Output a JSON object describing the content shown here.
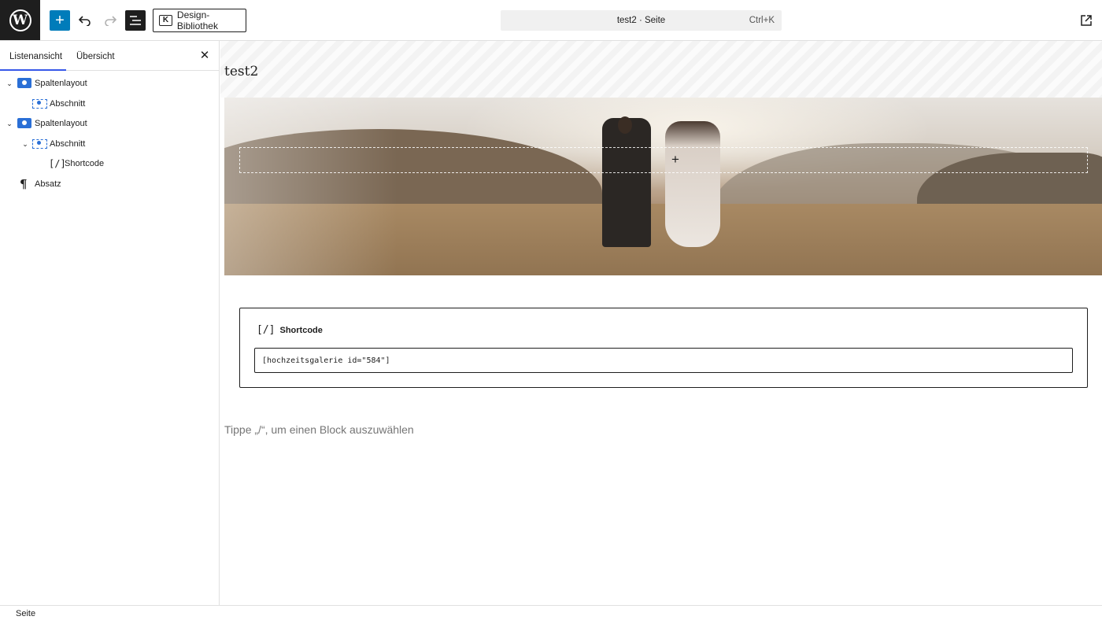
{
  "toolbar": {
    "logo_icon": "wordpress-icon",
    "add_icon": "plus-icon",
    "undo_icon": "undo-icon",
    "redo_icon": "redo-icon",
    "list_view_icon": "list-view-icon",
    "design_library_label": "Design-Bibliothek",
    "document_title": "test2 · Seite",
    "document_shortcut": "Ctrl+K",
    "view_icon": "external-link-icon",
    "accent_color": "#007cba"
  },
  "sidebar": {
    "tabs": [
      {
        "label": "Listenansicht",
        "active": true
      },
      {
        "label": "Übersicht",
        "active": false
      }
    ],
    "close_icon": "close-icon",
    "tree": [
      {
        "label": "Spaltenlayout",
        "icon": "columns-icon",
        "expanded": true,
        "level": 1
      },
      {
        "label": "Abschnitt",
        "icon": "section-icon",
        "expanded": false,
        "level": 2
      },
      {
        "label": "Spaltenlayout",
        "icon": "columns-icon",
        "expanded": true,
        "level": 1
      },
      {
        "label": "Abschnitt",
        "icon": "section-icon",
        "expanded": true,
        "level": 2
      },
      {
        "label": "Shortcode",
        "icon": "shortcode-icon",
        "expanded": false,
        "level": 3
      },
      {
        "label": "Absatz",
        "icon": "paragraph-icon",
        "expanded": false,
        "level": 1
      }
    ]
  },
  "canvas": {
    "page_title": "test2",
    "hero_image": "wedding-couple-in-field-photo",
    "drop_zone_icon": "plus-icon",
    "shortcode": {
      "icon_text": "[/]",
      "label": "Shortcode",
      "value": "[hochzeitsgalerie id=\"584\"]"
    },
    "placeholder": "Tippe „/“, um einen Block auszuwählen"
  },
  "footer": {
    "breadcrumb": "Seite"
  }
}
